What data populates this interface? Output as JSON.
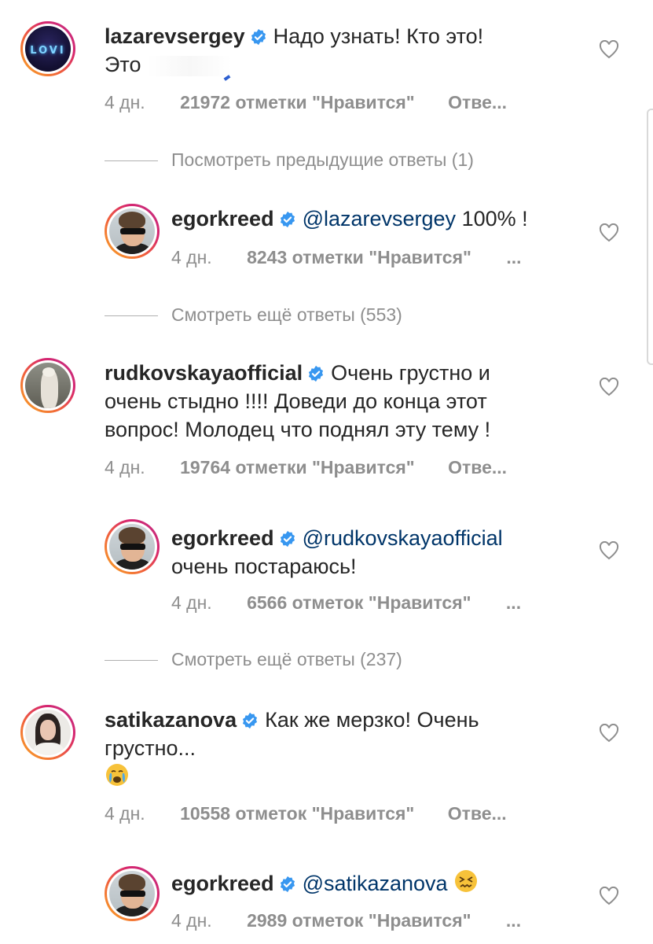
{
  "comments": [
    {
      "username": "lazarevsergey",
      "text": "Надо узнать! Кто это!",
      "text2": "Это",
      "time": "4 дн.",
      "likes": "21972 отметки \"Нравится\"",
      "reply": "Отве..."
    },
    {
      "username": "egorkreed",
      "mention": "@lazarevsergey",
      "text": "100% !",
      "time": "4 дн.",
      "likes": "8243 отметки \"Нравится\"",
      "more": "..."
    },
    {
      "username": "rudkovskayaofficial",
      "text": "Очень грустно и",
      "line2": "очень стыдно !!!! Доведи до конца этот",
      "line3": "вопрос! Молодец что поднял эту тему !",
      "time": "4 дн.",
      "likes": "19764 отметки \"Нравится\"",
      "reply": "Отве..."
    },
    {
      "username": "egorkreed",
      "mention": "@rudkovskayaofficial",
      "line2": "очень постараюсь!",
      "time": "4 дн.",
      "likes": "6566 отметок \"Нравится\"",
      "more": "..."
    },
    {
      "username": "satikazanova",
      "text": "Как же мерзко! Очень",
      "line2": "грустно...",
      "emoji": "crying-face",
      "time": "4 дн.",
      "likes": "10558 отметок \"Нравится\"",
      "reply": "Отве..."
    },
    {
      "username": "egorkreed",
      "mention": "@satikazanova",
      "emoji": "confounded-face",
      "time": "4 дн.",
      "likes": "2989 отметок \"Нравится\"",
      "more": "..."
    }
  ],
  "view_more": [
    "Посмотреть предыдущие ответы (1)",
    "Смотреть ещё ответы (553)",
    "Смотреть ещё ответы (237)"
  ],
  "colors": {
    "text": "#262626",
    "meta": "#8e8e8e",
    "mention": "#003569",
    "verified": "#3897f0"
  }
}
